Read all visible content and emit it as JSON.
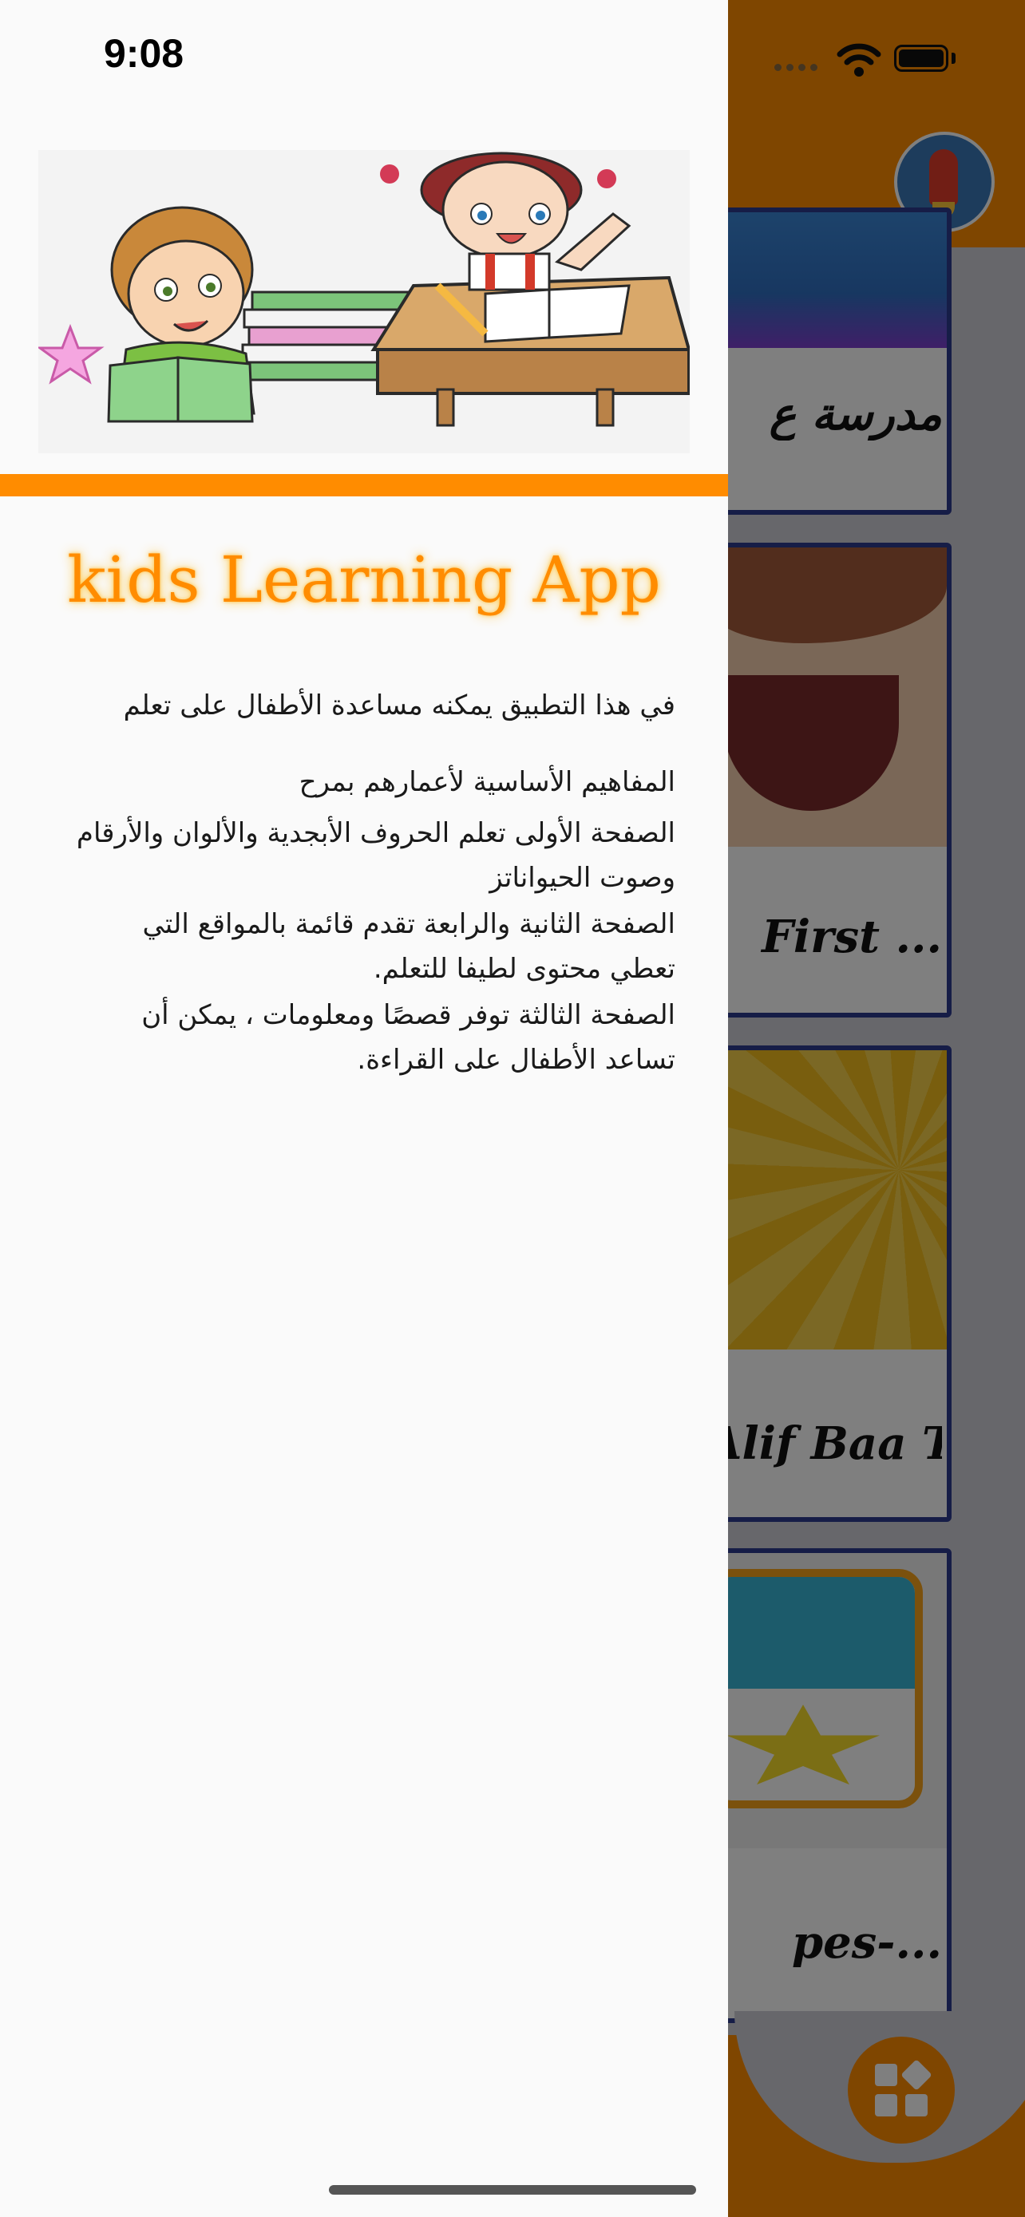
{
  "status_bar": {
    "time": "9:08"
  },
  "drawer": {
    "app_title": "kids Learning App",
    "description_lines": [
      "في هذا التطبيق يمكنه مساعدة الأطفال على تعلم",
      "المفاهيم الأساسية لأعمارهم بمرح",
      "الصفحة الأولى تعلم الحروف الأبجدية والألوان والأرقام",
      "وصوت الحيواناتز",
      "الصفحة الثانية والرابعة تقدم قائمة بالمواقع التي",
      "تعطي محتوى لطيفا للتعلم.",
      "الصفحة الثالثة توفر قصصًا ومعلومات ، يمكن أن",
      "تساعد الأطفال على القراءة."
    ]
  },
  "background": {
    "cards": [
      {
        "title": "مدرسة ع"
      },
      {
        "title": "First ..."
      },
      {
        "title": "Alif Baa Ta"
      },
      {
        "title": "pes-..."
      }
    ]
  },
  "colors": {
    "accent": "#ff8c00",
    "card_border": "#2c3a8f",
    "drawer_bg": "#fafafa"
  },
  "icons": {
    "fab": "grid-icon",
    "avatar": "rocket-icon"
  }
}
